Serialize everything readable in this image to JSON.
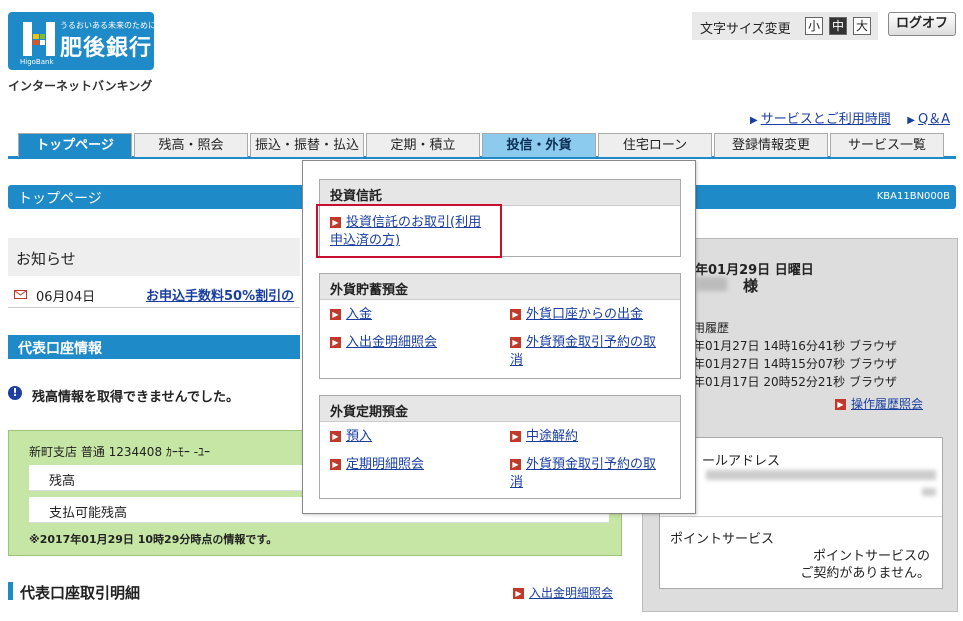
{
  "logo": {
    "tagline": "うるおいある未来のために。",
    "name": "肥後銀行",
    "sub": "HigoBank",
    "service": "インターネットバンキング"
  },
  "fontsize": {
    "label": "文字サイズ変更",
    "small": "小",
    "medium": "中",
    "large": "大",
    "selected": "中"
  },
  "logoff_label": "ログオフ",
  "toplinks": {
    "service_hours": "サービスとご利用時間",
    "qa": "Q＆A"
  },
  "nav": {
    "items": [
      {
        "label": "トップページ"
      },
      {
        "label": "残高・照会"
      },
      {
        "label": "振込・振替・払込"
      },
      {
        "label": "定期・積立"
      },
      {
        "label": "投信・外貨"
      },
      {
        "label": "住宅ローン"
      },
      {
        "label": "登録情報変更"
      },
      {
        "label": "サービス一覧"
      }
    ],
    "active": "トップページ",
    "hover": "投信・外貨"
  },
  "pagebar": {
    "title": "トップページ",
    "code": "KBA11BN000B"
  },
  "news": {
    "title": "お知らせ",
    "date": "06月04日",
    "link": "お申込手数料50%割引の"
  },
  "account": {
    "bar_title": "代表口座情報",
    "error": "残高情報を取得できませんでした。",
    "name": "新町支店 普通 1234408 ｶｰﾓｰ -ﾕｰ",
    "balance_label": "残高",
    "available_label": "支払可能残高",
    "note": "※2017年01月29日 10時29分時点の情報です。"
  },
  "detail": {
    "title": "代表口座取引明細",
    "link": "入出金明細照会"
  },
  "right": {
    "date": "年01月29日 日曜日",
    "sama": "様",
    "history_label": "用履歴",
    "history": [
      "年01月27日 14時16分41秒 ブラウザ",
      "年01月27日 14時15分07秒 ブラウザ",
      "年01月17日 20時52分21秒 ブラウザ"
    ],
    "history_link": "操作履歴照会",
    "email_label": "ールアドレス",
    "point_label": "ポイントサービス",
    "point_msg_1": "ポイントサービスの",
    "point_msg_2": "ご契約がありません。"
  },
  "dropdown": {
    "sec1": {
      "title": "投資信託",
      "item1_line1": "投資信託のお取引(利用",
      "item1_line2": "申込済の方)"
    },
    "sec2": {
      "title": "外貨貯蓄預金",
      "deposit": "入金",
      "withdraw": "外貨口座からの出金",
      "statement": "入出金明細照会",
      "reserve_line1": "外貨預金取引予約の取",
      "reserve_line2": "消"
    },
    "sec3": {
      "title": "外貨定期預金",
      "deposit": "預入",
      "cancel": "中途解約",
      "statement": "定期明細照会",
      "reserve_line1": "外貨預金取引予約の取",
      "reserve_line2": "消"
    }
  }
}
